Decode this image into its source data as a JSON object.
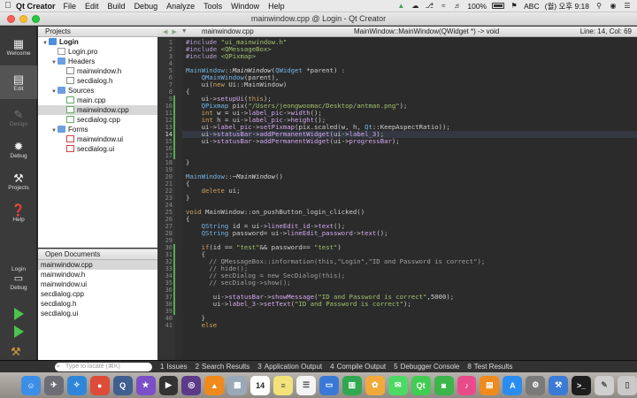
{
  "menubar": {
    "app_name": "Qt Creator",
    "menus": [
      "File",
      "Edit",
      "Build",
      "Debug",
      "Analyze",
      "Tools",
      "Window",
      "Help"
    ],
    "battery": "100%",
    "input_method": "ABC",
    "clock": "(월) 오후 9:18"
  },
  "window": {
    "title": "mainwindow.cpp @ Login - Qt Creator"
  },
  "modes": {
    "welcome": "Welcome",
    "edit": "Edit",
    "design": "Design",
    "debug": "Debug",
    "projects": "Projects",
    "help": "Help",
    "kit_project": "Login",
    "kit_config": "Debug"
  },
  "projects_pane": {
    "title": "Projects",
    "tree": [
      {
        "label": "Login",
        "depth": 0,
        "type": "project",
        "expanded": true
      },
      {
        "label": "Login.pro",
        "depth": 1,
        "type": "pro"
      },
      {
        "label": "Headers",
        "depth": 1,
        "type": "folder",
        "expanded": true
      },
      {
        "label": "mainwindow.h",
        "depth": 2,
        "type": "h"
      },
      {
        "label": "secdialog.h",
        "depth": 2,
        "type": "h"
      },
      {
        "label": "Sources",
        "depth": 1,
        "type": "folder",
        "expanded": true
      },
      {
        "label": "main.cpp",
        "depth": 2,
        "type": "cpp"
      },
      {
        "label": "mainwindow.cpp",
        "depth": 2,
        "type": "cpp",
        "selected": true
      },
      {
        "label": "secdialog.cpp",
        "depth": 2,
        "type": "cpp"
      },
      {
        "label": "Forms",
        "depth": 1,
        "type": "folder",
        "expanded": true
      },
      {
        "label": "mainwindow.ui",
        "depth": 2,
        "type": "ui"
      },
      {
        "label": "secdialog.ui",
        "depth": 2,
        "type": "ui"
      }
    ]
  },
  "open_documents": {
    "title": "Open Documents",
    "items": [
      {
        "label": "mainwindow.cpp",
        "selected": true
      },
      {
        "label": "mainwindow.h"
      },
      {
        "label": "mainwindow.ui"
      },
      {
        "label": "secdialog.cpp"
      },
      {
        "label": "secdialog.h"
      },
      {
        "label": "secdialog.ui"
      }
    ]
  },
  "editor_toolbar": {
    "file": "mainwindow.cpp",
    "function": "MainWindow::MainWindow(QWidget *) -> void",
    "position": "Line: 14, Col: 69"
  },
  "editor": {
    "current_line": 14,
    "lines": [
      {
        "n": 1,
        "t": "#include \"ui_mainwindow.h\""
      },
      {
        "n": 2,
        "t": "#include <QMessageBox>"
      },
      {
        "n": 3,
        "t": "#include <QPixmap>"
      },
      {
        "n": 4,
        "t": ""
      },
      {
        "n": 5,
        "t": "MainWindow::MainWindow(QWidget *parent) :"
      },
      {
        "n": 6,
        "t": "    QMainWindow(parent),"
      },
      {
        "n": 7,
        "t": "    ui(new Ui::MainWindow)"
      },
      {
        "n": 8,
        "t": "{"
      },
      {
        "n": 9,
        "t": "    ui->setupUi(this);"
      },
      {
        "n": 10,
        "t": "    QPixmap pix(\"/Users/jeongwoomac/Desktop/antman.png\");"
      },
      {
        "n": 11,
        "t": "    int w = ui->label_pic->width();"
      },
      {
        "n": 12,
        "t": "    int h = ui->label_pic->height();"
      },
      {
        "n": 13,
        "t": "    ui->label_pic->setPixmap(pix.scaled(w, h, Qt::KeepAspectRatio));"
      },
      {
        "n": 14,
        "t": "    ui->statusBar->addPermanentWidget(ui->label_3);"
      },
      {
        "n": 15,
        "t": "    ui->statusBar->addPermanentWidget(ui->progressBar);"
      },
      {
        "n": 16,
        "t": ""
      },
      {
        "n": 17,
        "t": ""
      },
      {
        "n": 18,
        "t": "}"
      },
      {
        "n": 19,
        "t": ""
      },
      {
        "n": 20,
        "t": "MainWindow::~MainWindow()"
      },
      {
        "n": 21,
        "t": "{"
      },
      {
        "n": 22,
        "t": "    delete ui;"
      },
      {
        "n": 23,
        "t": "}"
      },
      {
        "n": 24,
        "t": ""
      },
      {
        "n": 25,
        "t": "void MainWindow::on_pushButton_login_clicked()"
      },
      {
        "n": 26,
        "t": "{"
      },
      {
        "n": 27,
        "t": "    QString id = ui->lineEdit_id->text();"
      },
      {
        "n": 28,
        "t": "    QString password= ui->lineEdit_password->text();"
      },
      {
        "n": 29,
        "t": ""
      },
      {
        "n": 30,
        "t": "    if(id == \"test\"&& password== \"test\")"
      },
      {
        "n": 31,
        "t": "    {"
      },
      {
        "n": 32,
        "t": "      // QMessageBox::information(this,\"Login\",\"ID and Password is correct\");"
      },
      {
        "n": 33,
        "t": "      // hide();"
      },
      {
        "n": 34,
        "t": "      // secDialog = new SecDialog(this);"
      },
      {
        "n": 35,
        "t": "      // secDialog->show();"
      },
      {
        "n": 36,
        "t": ""
      },
      {
        "n": 37,
        "t": "       ui->statusBar->showMessage(\"ID and Password is correct\",5000);"
      },
      {
        "n": 38,
        "t": "       ui->label_3->setText(\"ID and Password is correct\");"
      },
      {
        "n": 39,
        "t": ""
      },
      {
        "n": 40,
        "t": "    }"
      },
      {
        "n": 41,
        "t": "    else"
      }
    ]
  },
  "bottombar": {
    "locator_placeholder": "Type to locate (⌘K)",
    "tabs": [
      {
        "num": "1",
        "label": "Issues"
      },
      {
        "num": "2",
        "label": "Search Results"
      },
      {
        "num": "3",
        "label": "Application Output"
      },
      {
        "num": "4",
        "label": "Compile Output"
      },
      {
        "num": "5",
        "label": "Debugger Console"
      },
      {
        "num": "8",
        "label": "Test Results"
      }
    ]
  },
  "dock": {
    "calendar_day": "14",
    "apps": [
      {
        "name": "finder-icon",
        "color": "#3d8ee8",
        "glyph": "☺"
      },
      {
        "name": "launchpad-icon",
        "color": "#6d6d78",
        "glyph": "✈"
      },
      {
        "name": "safari-icon",
        "color": "#2f86d9",
        "glyph": "✧"
      },
      {
        "name": "chrome-icon",
        "color": "#dd4b39",
        "glyph": "●"
      },
      {
        "name": "quicktime-icon",
        "color": "#3f5f8f",
        "glyph": "Q"
      },
      {
        "name": "imovie-icon",
        "color": "#7b4fc8",
        "glyph": "★"
      },
      {
        "name": "finalcut-icon",
        "color": "#333333",
        "glyph": "▶"
      },
      {
        "name": "motion-icon",
        "color": "#5c3a8a",
        "glyph": "◎"
      },
      {
        "name": "vlc-icon",
        "color": "#f08a1c",
        "glyph": "▲"
      },
      {
        "name": "preview-icon",
        "color": "#9aa8b8",
        "glyph": "▦"
      },
      {
        "name": "calendar-icon",
        "color": "#ffffff",
        "glyph": "14"
      },
      {
        "name": "notes-icon",
        "color": "#f3e27a",
        "glyph": "≡"
      },
      {
        "name": "reminders-icon",
        "color": "#f4f4f4",
        "glyph": "☰"
      },
      {
        "name": "keynote-icon",
        "color": "#3a78d8",
        "glyph": "▭"
      },
      {
        "name": "numbers-icon",
        "color": "#2fa84f",
        "glyph": "▥"
      },
      {
        "name": "photos-icon",
        "color": "#f2a93b",
        "glyph": "✿"
      },
      {
        "name": "messages-icon",
        "color": "#4cd964",
        "glyph": "✉"
      },
      {
        "name": "qtcreator-icon",
        "color": "#41cd52",
        "glyph": "Qt"
      },
      {
        "name": "facetime-icon",
        "color": "#3cb54a",
        "glyph": "◙"
      },
      {
        "name": "itunes-icon",
        "color": "#e94b8a",
        "glyph": "♪"
      },
      {
        "name": "books-icon",
        "color": "#f08a1c",
        "glyph": "▤"
      },
      {
        "name": "appstore-icon",
        "color": "#2a8cf0",
        "glyph": "A"
      },
      {
        "name": "systemprefs-icon",
        "color": "#7a7a7a",
        "glyph": "⚙"
      },
      {
        "name": "xcode-icon",
        "color": "#3a7bd5",
        "glyph": "⚒"
      },
      {
        "name": "terminal-icon",
        "color": "#1d1d1d",
        "glyph": ">_"
      },
      {
        "name": "scripteditor-icon",
        "color": "#cfcfcf",
        "glyph": "✎"
      },
      {
        "name": "trash-icon",
        "color": "#c9c9c9",
        "glyph": "▯"
      }
    ]
  },
  "colors": {
    "editor_bg": "#2b2b2b",
    "mode_bar": "#3a3a3a",
    "run_green": "#4cc34c",
    "changed_marker": "#4caf50"
  }
}
